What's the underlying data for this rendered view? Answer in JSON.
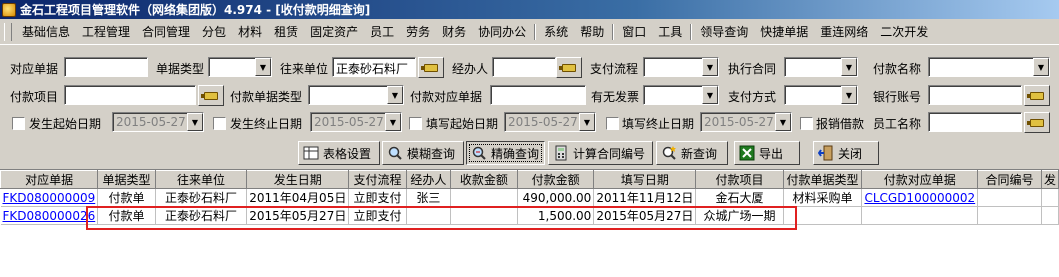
{
  "window": {
    "title": "金石工程项目管理软件（网络集团版）4.974 - [收付款明细查询]"
  },
  "menu": [
    "基础信息",
    "工程管理",
    "合同管理",
    "分包",
    "材料",
    "租赁",
    "固定资产",
    "员工",
    "劳务",
    "财务",
    "协同办公",
    "系统",
    "帮助",
    "窗口",
    "工具",
    "领导查询",
    "快捷单据",
    "重连网络",
    "二次开发"
  ],
  "filters": {
    "row1": {
      "doc_label": "对应单据",
      "doc_value": "",
      "type_label": "单据类型",
      "type_value": "",
      "unit_label": "往来单位",
      "unit_value": "正泰砂石料厂",
      "handler_label": "经办人",
      "handler_value": "",
      "flow_label": "支付流程",
      "flow_value": "",
      "contract_label": "执行合同",
      "contract_value": "",
      "payname_label": "付款名称",
      "payname_value": ""
    },
    "row2": {
      "item_label": "付款项目",
      "item_value": "",
      "paytype_label": "付款单据类型",
      "paytype_value": "",
      "paydoc_label": "付款对应单据",
      "paydoc_value": "",
      "invoice_label": "有无发票",
      "invoice_value": "",
      "method_label": "支付方式",
      "method_value": "",
      "bank_label": "银行账号",
      "bank_value": ""
    },
    "row3": {
      "start_label": "发生起始日期",
      "start_value": "2015-05-27",
      "end_label": "发生终止日期",
      "end_value": "2015-05-27",
      "fill_start_label": "填写起始日期",
      "fill_start_value": "2015-05-27",
      "fill_end_label": "填写终止日期",
      "fill_end_value": "2015-05-27",
      "reimb_label": "报销借款",
      "staff_label": "员工名称",
      "staff_value": ""
    }
  },
  "toolbar": {
    "table_settings": "表格设置",
    "fuzzy_query": "模糊查询",
    "exact_query": "精确查询",
    "calc_contract_no": "计算合同编号",
    "new_query": "新查询",
    "export": "导出",
    "close": "关闭"
  },
  "grid": {
    "columns": [
      "对应单据",
      "单据类型",
      "往来单位",
      "发生日期",
      "支付流程",
      "经办人",
      "收款金额",
      "付款金额",
      "填写日期",
      "付款项目",
      "付款单据类型",
      "付款对应单据",
      "合同编号",
      "发"
    ],
    "rows": [
      [
        "FKD080000009",
        "付款单",
        "正泰砂石料厂",
        "2011年04月05日",
        "立即支付",
        "张三",
        "",
        "490,000.00",
        "2011年11月12日",
        "金石大厦",
        "材料采购单",
        "CLCGD100000002",
        ""
      ],
      [
        "FKD080000026",
        "付款单",
        "正泰砂石料厂",
        "2015年05月27日",
        "立即支付",
        "",
        "",
        "1,500.00",
        "2015年05月27日",
        "众城广场一期",
        "",
        "",
        ""
      ]
    ]
  }
}
